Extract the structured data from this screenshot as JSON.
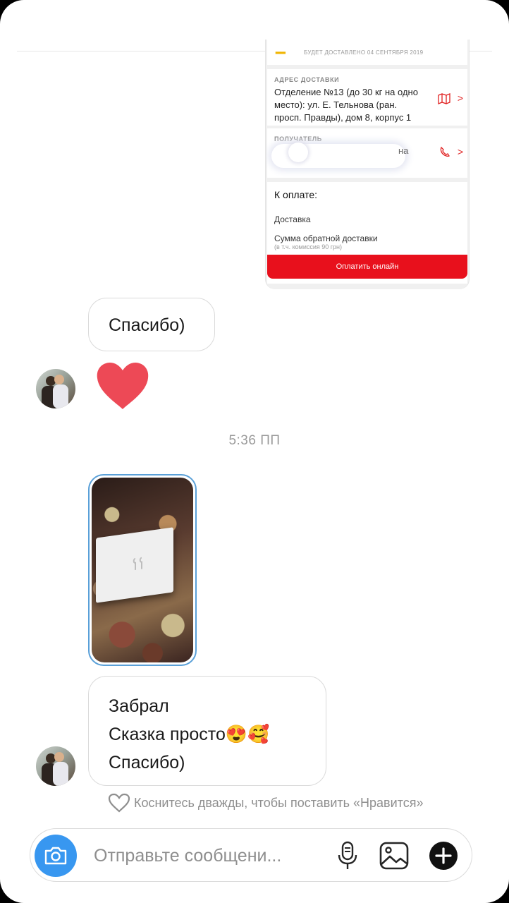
{
  "shared_screenshot": {
    "delivered_note": "БУДЕТ ДОСТАВЛЕНО 04 СЕНТЯБРЯ 2019",
    "address_label": "АДРЕС ДОСТАВКИ",
    "address_lines": [
      "Отделение №13 (до 30 кг на одно",
      "место): ул. Е. Тельнова (ран.",
      "просп. Правды), дом 8, корпус 1"
    ],
    "recipient_label": "ПОЛУЧАТЕЛЬ",
    "recipient_tail": "на",
    "payment_title": "К оплате:",
    "delivery_row": "Доставка",
    "cod_row": "Сумма обратной доставки",
    "cod_note": "(в т.ч. комиссия 90 грн)",
    "pay_button": "Оплатить онлайн"
  },
  "messages": {
    "thanks_1": "Спасибо)",
    "timestamp": "5:36 ПП",
    "final_lines": [
      "Забрал",
      "Сказка просто😍🥰",
      "Спасибо)"
    ]
  },
  "hint": "Коснитесь дважды, чтобы поставить «Нравится»",
  "composer": {
    "placeholder": "Отправьте сообщени..."
  },
  "icons": {
    "heart_reaction": "heart-icon",
    "camera": "camera-icon",
    "mic": "microphone-icon",
    "gallery": "gallery-icon",
    "plus": "plus-icon",
    "like_outline": "heart-outline-icon"
  },
  "colors": {
    "heart": "#ed4956",
    "accent": "#3897f0",
    "pay_red": "#e8101c"
  }
}
